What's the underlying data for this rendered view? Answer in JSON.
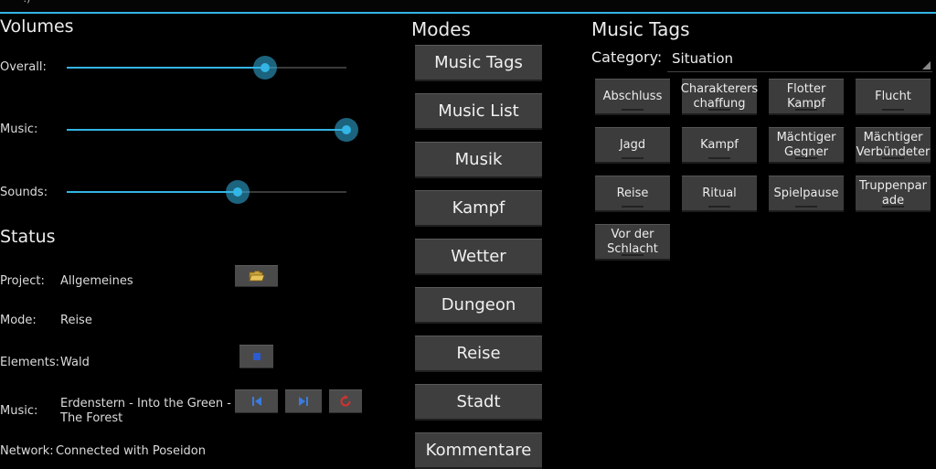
{
  "topbar": {
    "glyph": "·.)"
  },
  "volumes": {
    "title": "Volumes",
    "sliders": [
      {
        "label": "Overall:",
        "value": 0.71
      },
      {
        "label": "Music:",
        "value": 1.0
      },
      {
        "label": "Sounds:",
        "value": 0.61
      }
    ]
  },
  "status": {
    "title": "Status",
    "project": {
      "label": "Project:",
      "value": "Allgemeines"
    },
    "mode": {
      "label": "Mode:",
      "value": "Reise"
    },
    "elements": {
      "label": "Elements:",
      "value": "Wald"
    },
    "music": {
      "label": "Music:",
      "line1": "Erdenstern - Into the Green -",
      "line2": "The Forest"
    },
    "network": {
      "label": "Network:",
      "value": "Connected with Poseidon"
    },
    "icons": [
      "folder-icon",
      "stop-icon",
      "skip-previous-icon",
      "skip-next-icon",
      "repeat-icon"
    ],
    "colors": {
      "accent": "#33b5e5",
      "media": "#3a7be0",
      "repeat": "#d83030"
    }
  },
  "modes": {
    "title": "Modes",
    "items": [
      "Music Tags",
      "Music List",
      "Musik",
      "Kampf",
      "Wetter",
      "Dungeon",
      "Reise",
      "Stadt",
      "Kommentare"
    ]
  },
  "music_tags": {
    "title": "Music Tags",
    "category_label": "Category:",
    "category_value": "Situation",
    "tags": [
      {
        "line1": "Abschluss",
        "line2": ""
      },
      {
        "line1": "Charakterers",
        "line2": "chaffung"
      },
      {
        "line1": "Flotter",
        "line2": "Kampf"
      },
      {
        "line1": "Flucht",
        "line2": ""
      },
      {
        "line1": "Jagd",
        "line2": ""
      },
      {
        "line1": "Kampf",
        "line2": ""
      },
      {
        "line1": "Mächtiger",
        "line2": "Gegner"
      },
      {
        "line1": "Mächtiger",
        "line2": "Verbündeter"
      },
      {
        "line1": "Reise",
        "line2": ""
      },
      {
        "line1": "Ritual",
        "line2": ""
      },
      {
        "line1": "Spielpause",
        "line2": ""
      },
      {
        "line1": "Truppenpar",
        "line2": "ade"
      },
      {
        "line1": "Vor der",
        "line2": "Schlacht"
      }
    ]
  }
}
